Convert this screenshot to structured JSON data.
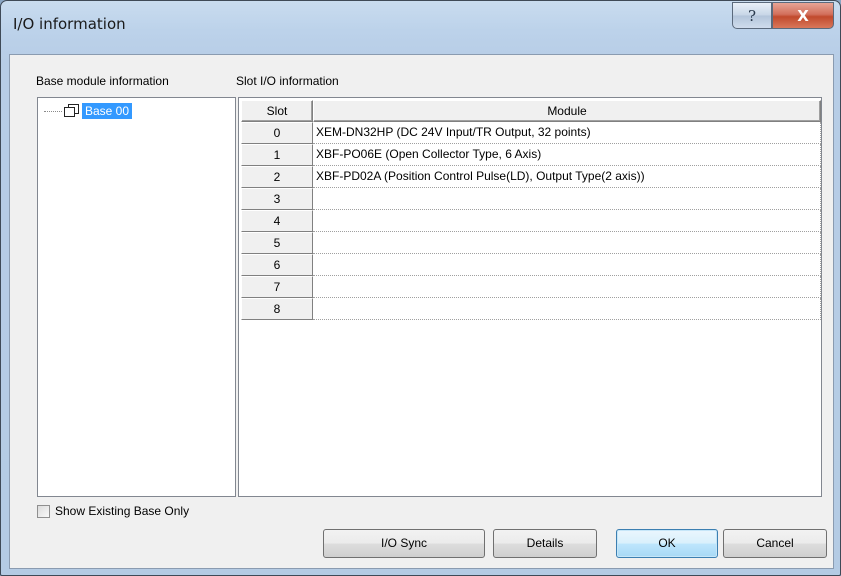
{
  "window": {
    "title": "I/O information"
  },
  "caption_buttons": {
    "help": "?",
    "close": "X"
  },
  "base_panel": {
    "label": "Base module information",
    "items": [
      {
        "label": "Base 00",
        "selected": true
      }
    ]
  },
  "slot_panel": {
    "label": "Slot I/O information",
    "columns": [
      "Slot",
      "Module"
    ],
    "rows": [
      {
        "slot": "0",
        "module": "XEM-DN32HP (DC 24V Input/TR Output, 32 points)"
      },
      {
        "slot": "1",
        "module": "XBF-PO06E (Open Collector Type, 6 Axis)"
      },
      {
        "slot": "2",
        "module": "XBF-PD02A (Position Control  Pulse(LD), Output Type(2 axis))"
      },
      {
        "slot": "3",
        "module": ""
      },
      {
        "slot": "4",
        "module": ""
      },
      {
        "slot": "5",
        "module": ""
      },
      {
        "slot": "6",
        "module": ""
      },
      {
        "slot": "7",
        "module": ""
      },
      {
        "slot": "8",
        "module": ""
      }
    ]
  },
  "show_existing": {
    "label": "Show Existing Base Only",
    "checked": false
  },
  "buttons": {
    "io_sync": "I/O Sync",
    "details": "Details",
    "ok": "OK",
    "cancel": "Cancel"
  },
  "colors": {
    "selection": "#3399ff",
    "ok_border": "#3c7fb1",
    "close_red": "#c14a2d"
  }
}
